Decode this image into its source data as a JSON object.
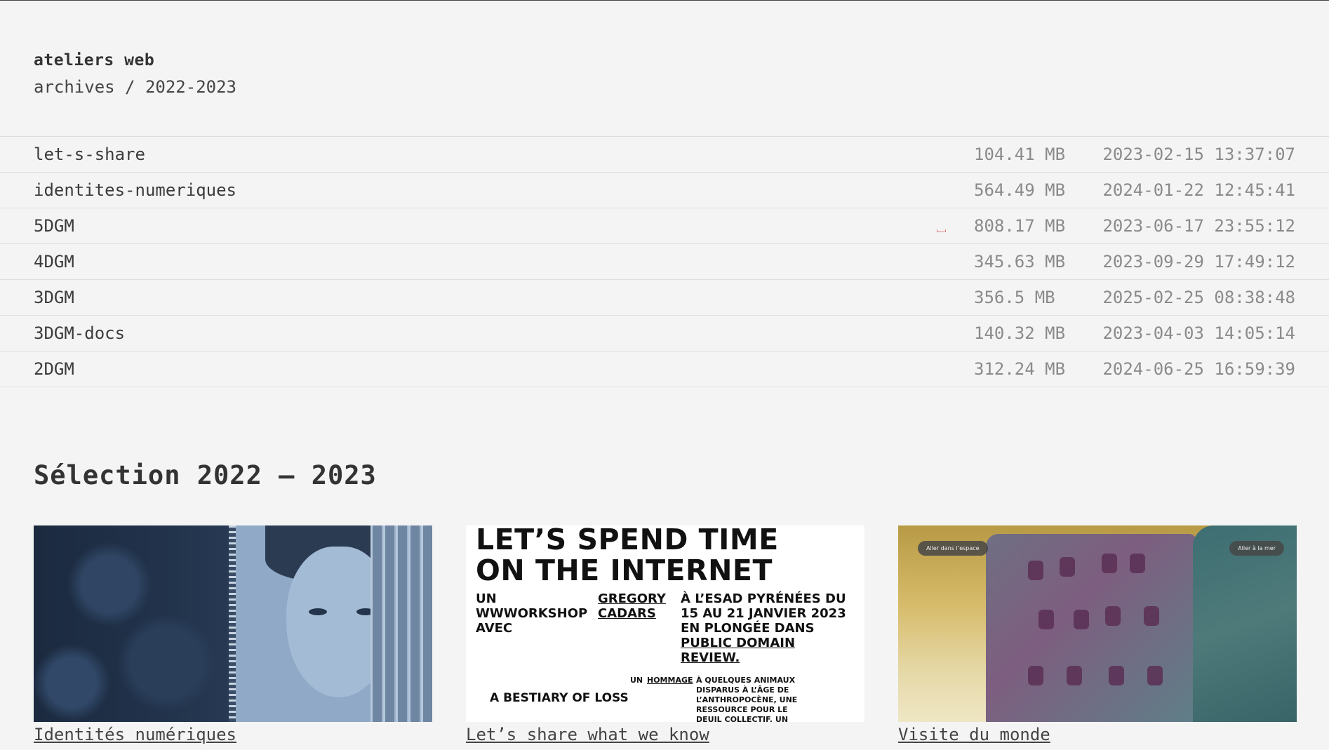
{
  "header": {
    "site_title": "ateliers web",
    "breadcrumb": "archives / 2022-2023"
  },
  "files": [
    {
      "name": "let-s-share",
      "size": "104.41 MB",
      "date": "2023-02-15 13:37:07"
    },
    {
      "name": "identites-numeriques",
      "size": "564.49 MB",
      "date": "2024-01-22 12:45:41"
    },
    {
      "name": "5DGM",
      "size": "808.17 MB",
      "date": "2023-06-17 23:55:12"
    },
    {
      "name": "4DGM",
      "size": "345.63 MB",
      "date": "2023-09-29 17:49:12"
    },
    {
      "name": "3DGM",
      "size": "356.5 MB",
      "date": "2025-02-25 08:38:48"
    },
    {
      "name": "3DGM-docs",
      "size": "140.32 MB",
      "date": "2023-04-03 14:05:14"
    },
    {
      "name": "2DGM",
      "size": "312.24 MB",
      "date": "2024-06-25 16:59:39"
    }
  ],
  "selection": {
    "title": "Sélection 2022 – 2023",
    "cards": [
      {
        "label": "Identités numériques",
        "image": "identites-numeriques-photo"
      },
      {
        "label": "Let’s share what we know",
        "image": "lets-spend-time-poster"
      },
      {
        "label": "Visite du monde",
        "image": "watercolor-buildings"
      }
    ]
  },
  "poster": {
    "title_line1": "LET’S SPEND TIME",
    "title_line2": "ON THE INTERNET",
    "col1": "UN WWWORKSHOP AVEC",
    "col2": "GREGORY CADARS",
    "col3_line1": "À L’ESAD PYRÉNÉES DU",
    "col3_line2": "15 AU 21 JANVIER 2023",
    "col3_line3": "EN PLONGÉE DANS",
    "col3_line4": "PUBLIC DOMAIN",
    "col3_line5": "REVIEW.",
    "bestiary": "A BESTIARY OF LOSS",
    "un": "UN",
    "hommage": "HOMMAGE",
    "small_text": "À QUELQUES ANIMAUX DISPARUS À L’ÂGE DE L’ANTHROPOCÈNE, UNE RESSOURCE POUR LE DEUIL COLLECTIF, UN MOYEN DE VISUALISER L’AMPLEUR DE LA"
  },
  "visit": {
    "pill_left": "Aller dans l’espace",
    "pill_right": "Aller à la mer"
  }
}
